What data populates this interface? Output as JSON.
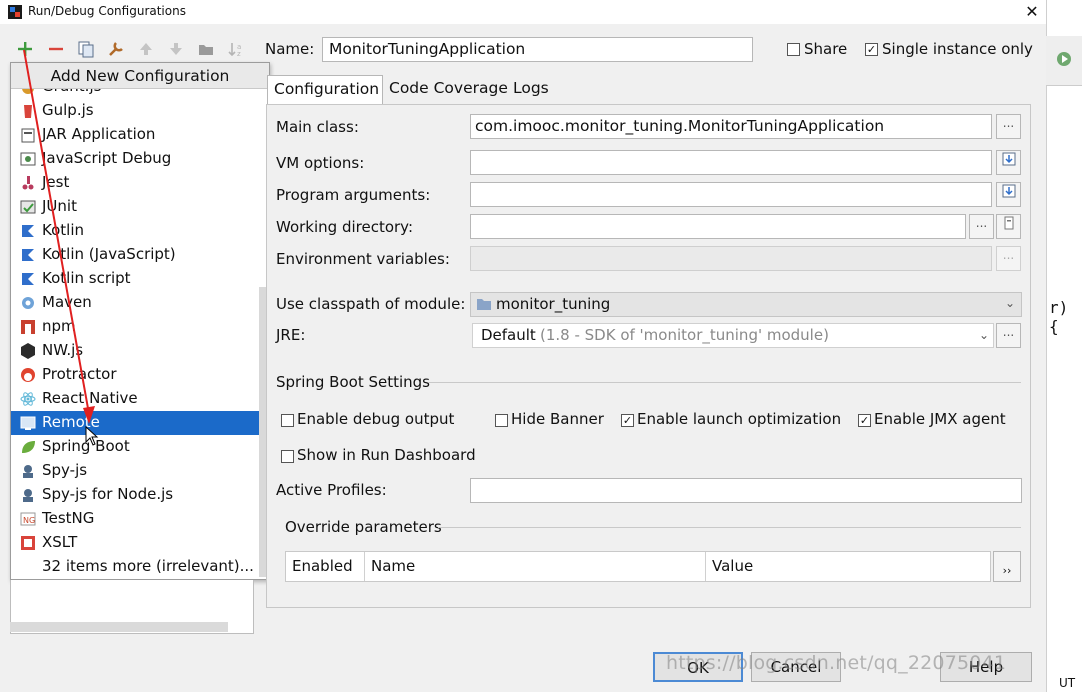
{
  "window": {
    "title": "Run/Debug Configurations",
    "close_glyph": "✕"
  },
  "toolbar": {
    "icons": [
      "add-icon",
      "remove-icon",
      "copy-icon",
      "edit-defaults-icon",
      "move-up-icon",
      "move-down-icon",
      "folder-icon",
      "sort-icon"
    ]
  },
  "popup": {
    "header": "Add New Configuration",
    "items": [
      {
        "label": "Grunt.js",
        "icon": "grunt-icon"
      },
      {
        "label": "Gulp.js",
        "icon": "gulp-icon"
      },
      {
        "label": "JAR Application",
        "icon": "jar-icon"
      },
      {
        "label": "JavaScript Debug",
        "icon": "js-debug-icon"
      },
      {
        "label": "Jest",
        "icon": "jest-icon"
      },
      {
        "label": "JUnit",
        "icon": "junit-icon"
      },
      {
        "label": "Kotlin",
        "icon": "kotlin-icon"
      },
      {
        "label": "Kotlin (JavaScript)",
        "icon": "kotlin-js-icon"
      },
      {
        "label": "Kotlin script",
        "icon": "kotlin-script-icon"
      },
      {
        "label": "Maven",
        "icon": "maven-icon"
      },
      {
        "label": "npm",
        "icon": "npm-icon"
      },
      {
        "label": "NW.js",
        "icon": "nwjs-icon"
      },
      {
        "label": "Protractor",
        "icon": "protractor-icon"
      },
      {
        "label": "React Native",
        "icon": "react-icon"
      },
      {
        "label": "Remote",
        "icon": "remote-icon",
        "selected": true
      },
      {
        "label": "Spring Boot",
        "icon": "spring-boot-icon"
      },
      {
        "label": "Spy-js",
        "icon": "spy-js-icon"
      },
      {
        "label": "Spy-js for Node.js",
        "icon": "spy-js-node-icon"
      },
      {
        "label": "TestNG",
        "icon": "testng-icon"
      },
      {
        "label": "XSLT",
        "icon": "xslt-icon"
      },
      {
        "label": "32 items more (irrelevant)...",
        "icon": ""
      }
    ]
  },
  "name_row": {
    "label": "Name:",
    "value": "MonitorTuningApplication",
    "share_label": "Share",
    "share_checked": false,
    "single_instance_label": "Single instance only",
    "single_instance_checked": true
  },
  "tabs": [
    {
      "label": "Configuration",
      "active": true
    },
    {
      "label": "Code Coverage",
      "active": false
    },
    {
      "label": "Logs",
      "active": false
    }
  ],
  "form": {
    "main_class_label": "Main class:",
    "main_class_value": "com.imooc.monitor_tuning.MonitorTuningApplication",
    "vm_options_label": "VM options:",
    "vm_options_value": "",
    "program_args_label": "Program arguments:",
    "program_args_value": "",
    "working_dir_label": "Working directory:",
    "working_dir_value": "",
    "env_vars_label": "Environment variables:",
    "env_vars_value": "",
    "classpath_label": "Use classpath of module:",
    "classpath_value": "monitor_tuning",
    "jre_label": "JRE:",
    "jre_value": "Default",
    "jre_detail": "(1.8 - SDK of 'monitor_tuning' module)",
    "ellipsis": "...",
    "chevron": "⌄"
  },
  "spring_boot": {
    "section_title": "Spring Boot Settings",
    "enable_debug_output": {
      "label": "Enable debug output",
      "checked": false
    },
    "hide_banner": {
      "label": "Hide Banner",
      "checked": false
    },
    "enable_launch_optimization": {
      "label": "Enable launch optimization",
      "checked": true
    },
    "enable_jmx_agent": {
      "label": "Enable JMX agent",
      "checked": true
    },
    "show_in_run_dashboard": {
      "label": "Show in Run Dashboard",
      "checked": false
    },
    "active_profiles_label": "Active Profiles:",
    "active_profiles_value": ""
  },
  "override": {
    "section_title": "Override parameters",
    "columns": [
      "Enabled",
      "Name",
      "Value"
    ],
    "more_glyph": "››"
  },
  "buttons": {
    "ok": "OK",
    "cancel": "Cancel",
    "help": "Help"
  },
  "background": {
    "code_fragment": "r) {",
    "status_fragment": "UT"
  },
  "watermark": "https://blog.csdn.net/qq_22075041",
  "colors": {
    "selection": "#1b6ac9",
    "add_green": "#3d9a3d",
    "remove_red": "#d9443b",
    "kotlin": "#2f6ecb",
    "pointer_arrow": "#e02020"
  }
}
